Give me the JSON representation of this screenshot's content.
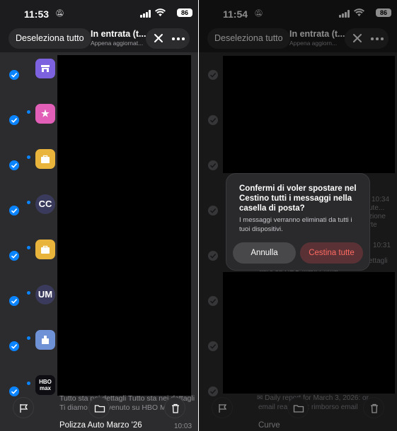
{
  "left": {
    "status": {
      "time": "11:53",
      "battery": "86"
    },
    "header": {
      "deselect_label": "Deseleziona tutto",
      "mailbox_title": "In entrata (t...",
      "mailbox_subtitle": "Appena aggiornat..."
    },
    "rows": [
      {
        "avatar_color": "#7d62e0",
        "avatar_icon": "storefront-icon",
        "unread": false
      },
      {
        "avatar_color": "#e25fb7",
        "avatar_icon": "star-icon",
        "unread": true
      },
      {
        "avatar_color": "#e9b43c",
        "avatar_icon": "shopping-bag-icon",
        "unread": true
      },
      {
        "avatar_text": "CC",
        "unread": true
      },
      {
        "avatar_color": "#e9b43c",
        "avatar_icon": "shopping-bag-icon",
        "unread": true
      },
      {
        "avatar_text": "UM",
        "unread": true
      },
      {
        "avatar_color": "#6f91d6",
        "avatar_icon": "building-icon",
        "unread": true
      },
      {
        "avatar_text": "HBO max",
        "unread": true
      }
    ],
    "preview_line1": "Tutto sta nei dettagli Tutto sta nei dettagli",
    "preview_line2": "Ti diamo il benvenuto su HBO Max",
    "last_sender": "Polizza Auto Marzo '26",
    "last_time": "10:03"
  },
  "right": {
    "status": {
      "time": "11:54",
      "battery": "86"
    },
    "header": {
      "deselect_label": "Deseleziona tutto",
      "mailbox_title": "In entrata (t...",
      "mailbox_subtitle": "Appena aggiorn..."
    },
    "ghost": {
      "time1": "10:34",
      "frag1": "ute...",
      "frag2": "zione",
      "frag3": "rte",
      "time2": "10:31",
      "frag4": "ettagli",
      "frag5": "tturo su HBO Max! Prima",
      "preview_line1": "Daily report for March 3, 2026: or...",
      "preview_line2": "email read from: rimborso email",
      "last_sender": "Curve"
    },
    "alert": {
      "title": "Confermi di voler spostare nel Cestino tutti i messaggi nella casella di posta?",
      "body": "I messaggi verranno eliminati da tutti i tuoi dispositivi.",
      "cancel_label": "Annulla",
      "confirm_label": "Cestina tutte"
    }
  }
}
